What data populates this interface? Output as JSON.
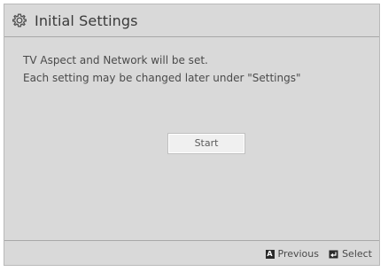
{
  "title": "Initial Settings",
  "message": {
    "line1": "TV Aspect and Network will be set.",
    "line2": "Each setting may be changed later under \"Settings\""
  },
  "start_button": {
    "label": "Start"
  },
  "footer": {
    "previous": {
      "key": "A",
      "label": "Previous"
    },
    "select": {
      "label": "Select"
    }
  },
  "icons": {
    "title": "gear-icon",
    "previous": "a-key-icon",
    "select": "enter-icon"
  },
  "colors": {
    "panel": "#d9d9d9",
    "button": "#f0f0f0",
    "text": "#4a4a4a"
  }
}
